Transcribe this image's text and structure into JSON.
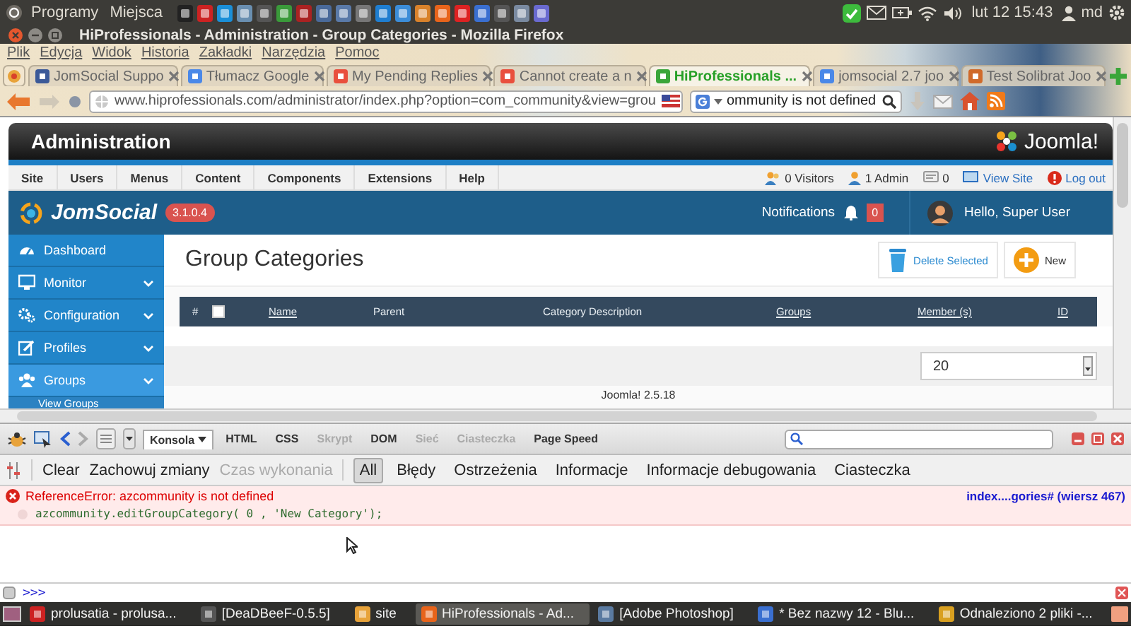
{
  "desktop_panel": {
    "menus": [
      "Programy",
      "Miejsca"
    ],
    "clock": "lut 12 15:43",
    "user": "md"
  },
  "window": {
    "title": "HiProfessionals - Administration - Group Categories - Mozilla Firefox"
  },
  "menu_bar": [
    "Plik",
    "Edycja",
    "Widok",
    "Historia",
    "Zakładki",
    "Narzędzia",
    "Pomoc"
  ],
  "tabs": [
    {
      "label": "JomSocial Suppo",
      "selected": false
    },
    {
      "label": "Tłumacz Google",
      "selected": false
    },
    {
      "label": "My Pending Replies",
      "selected": false
    },
    {
      "label": "Cannot create a n",
      "selected": false
    },
    {
      "label": "HiProfessionals ...",
      "selected": true
    },
    {
      "label": "jomsocial 2.7 joo",
      "selected": false
    },
    {
      "label": "Test Solibrat Joo",
      "selected": false
    }
  ],
  "address_bar": {
    "url": "www.hiprofessionals.com/administrator/index.php?option=com_community&view=grou"
  },
  "search_bar": {
    "value": "ommunity is not defined"
  },
  "admin": {
    "title": "Administration",
    "logo_text": "Joomla!",
    "menu": [
      "Site",
      "Users",
      "Menus",
      "Content",
      "Components",
      "Extensions",
      "Help"
    ],
    "status": [
      {
        "kind": "visitors",
        "label": "0 Visitors"
      },
      {
        "kind": "admins",
        "label": "1 Admin"
      },
      {
        "kind": "messages",
        "label": "0"
      },
      {
        "kind": "view_site",
        "label": "View Site"
      },
      {
        "kind": "logout",
        "label": "Log out"
      }
    ]
  },
  "jomsocial": {
    "logo_text": "JomSocial",
    "version": "3.1.0.4",
    "notifications_label": "Notifications",
    "notifications_count": "0",
    "greeting": "Hello, Super User"
  },
  "sidebar": {
    "items": [
      {
        "kind": "dashboard",
        "label": "Dashboard",
        "expandable": false,
        "selected": false
      },
      {
        "kind": "monitor",
        "label": "Monitor",
        "expandable": true,
        "selected": false
      },
      {
        "kind": "configuration",
        "label": "Configuration",
        "expandable": true,
        "selected": false
      },
      {
        "kind": "profiles",
        "label": "Profiles",
        "expandable": true,
        "selected": false
      },
      {
        "kind": "groups",
        "label": "Groups",
        "expandable": true,
        "selected": true
      }
    ],
    "subitems": [
      "View Groups"
    ]
  },
  "page_title": "Group Categories",
  "toolbar": [
    {
      "kind": "delete",
      "label": "Delete Selected"
    },
    {
      "kind": "new",
      "label": "New"
    }
  ],
  "table": {
    "columns": [
      {
        "kind": "text",
        "label": "#"
      },
      {
        "kind": "checkbox",
        "checked": false
      },
      {
        "kind": "link",
        "label": "Name"
      },
      {
        "kind": "text",
        "label": "Parent"
      },
      {
        "kind": "text",
        "label": "Category Description"
      },
      {
        "kind": "link",
        "label": "Groups"
      },
      {
        "kind": "link",
        "label": "Member (s)"
      },
      {
        "kind": "link",
        "label": "ID"
      }
    ]
  },
  "page_limit": "20",
  "footer": "Joomla! 2.5.18",
  "firebug": {
    "panels": [
      {
        "label": "Konsola",
        "dropdown": true,
        "selected": true,
        "disabled": false
      },
      {
        "label": "HTML",
        "dropdown": false,
        "selected": false,
        "disabled": false
      },
      {
        "label": "CSS",
        "dropdown": false,
        "selected": false,
        "disabled": false
      },
      {
        "label": "Skrypt",
        "dropdown": false,
        "selected": false,
        "disabled": true
      },
      {
        "label": "DOM",
        "dropdown": false,
        "selected": false,
        "disabled": false
      },
      {
        "label": "Sieć",
        "dropdown": false,
        "selected": false,
        "disabled": true
      },
      {
        "label": "Ciasteczka",
        "dropdown": false,
        "selected": false,
        "disabled": true
      },
      {
        "label": "Page Speed",
        "dropdown": false,
        "selected": false,
        "disabled": false
      }
    ],
    "actions": [
      {
        "label": "Clear",
        "disabled": false
      },
      {
        "label": "Zachowuj zmiany",
        "disabled": false
      },
      {
        "label": "Czas wykonania",
        "disabled": true
      }
    ],
    "filters": [
      {
        "label": "All",
        "selected": true
      },
      {
        "label": "Błędy",
        "selected": false
      },
      {
        "label": "Ostrzeżenia",
        "selected": false
      },
      {
        "label": "Informacje",
        "selected": false
      },
      {
        "label": "Informacje debugowania",
        "selected": false
      },
      {
        "label": "Ciasteczka",
        "selected": false
      }
    ],
    "log": [
      {
        "kind": "error",
        "message": "ReferenceError: azcommunity is not defined",
        "source": "index....gories# (wiersz 467)",
        "code": "azcommunity.editGroupCategory( 0 , 'New Category');"
      }
    ],
    "prompt": ">>>"
  },
  "taskbar": [
    {
      "label": "prolusatia - prolusa...",
      "selected": false
    },
    {
      "label": "[DeaDBeeF-0.5.5]",
      "selected": false
    },
    {
      "label": "site",
      "selected": false
    },
    {
      "label": "HiProfessionals - Ad...",
      "selected": true
    },
    {
      "label": "[Adobe Photoshop]",
      "selected": false
    },
    {
      "label": "* Bez nazwy 12 - Blu...",
      "selected": false
    },
    {
      "label": "Odnaleziono 2 pliki -...",
      "selected": false
    }
  ]
}
